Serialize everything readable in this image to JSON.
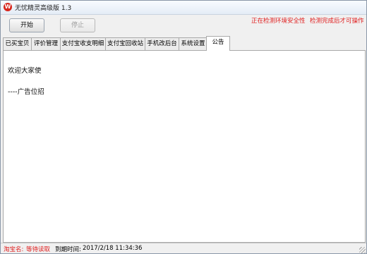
{
  "window": {
    "title": "无忧精灵高级版 1.3",
    "icon_name": "app-logo-icon",
    "icon_glyph": "W"
  },
  "toolbar": {
    "start_label": "开始",
    "stop_label": "停止",
    "status_checking": "正在检测环境安全性",
    "status_wait": "检测完成后才可操作"
  },
  "tabs": [
    {
      "label": "已买宝贝"
    },
    {
      "label": "评价管理"
    },
    {
      "label": "支付宝收支明细"
    },
    {
      "label": "支付宝回收站"
    },
    {
      "label": "手机改后台"
    },
    {
      "label": "系统设置"
    },
    {
      "label": "公告",
      "active": true
    }
  ],
  "notice": {
    "line1": "欢迎大家使",
    "line2": "----广告位招"
  },
  "statusbar": {
    "taobao_label": "淘宝名:",
    "taobao_value": "等待读取",
    "expiry_label": "到期时间:",
    "expiry_value": "2017/2/18 11:34:36"
  },
  "colors": {
    "status_red": "#e02020",
    "icon_red": "#d8261c"
  }
}
